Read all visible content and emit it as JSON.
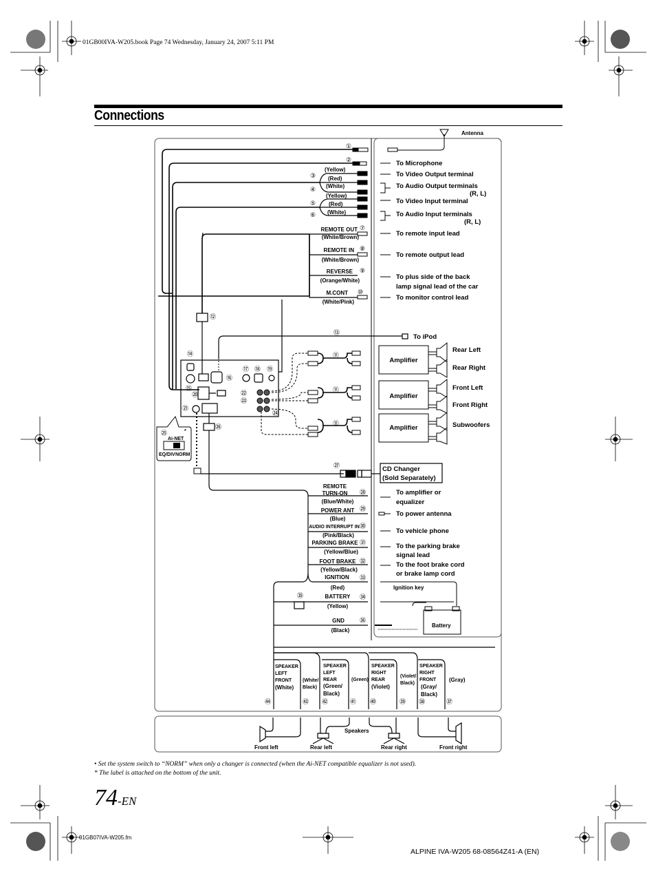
{
  "header": {
    "book_meta": "01GB00IVA-W205.book  Page 74  Wednesday, January 24, 2007  5:11 PM",
    "title": "Connections"
  },
  "diagram": {
    "antenna_label": "Antenna",
    "connectors": [
      {
        "num": "①",
        "wire_color": "",
        "destination": "To Microphone"
      },
      {
        "num": "②",
        "wire_color": "",
        "destination": "To Video Output terminal"
      },
      {
        "num": "③",
        "wire_color": "(Yellow) (Red)",
        "destination": "To Audio Output terminals (R, L)"
      },
      {
        "num": "④",
        "wire_color": "(White)",
        "destination": ""
      },
      {
        "num": "⑤",
        "wire_color": "(Yellow) (Red)",
        "destination": "To Video Input terminal"
      },
      {
        "num": "⑥",
        "wire_color": "(White)",
        "destination": "To Audio Input terminals (R, L)"
      }
    ],
    "rca_colors": [
      "(Yellow)",
      "(Red)",
      "(White)",
      "(Yellow)",
      "(Red)",
      "(White)"
    ],
    "nums_top": [
      "①",
      "②",
      "③",
      "④",
      "⑤",
      "⑥"
    ],
    "dest_top": [
      "To Microphone",
      "To Video Output terminal",
      "To Audio Output terminals",
      "(R, L)",
      "To Video Input terminal",
      "To Audio Input terminals",
      "(R, L)"
    ],
    "leads_mid": [
      {
        "name": "REMOTE OUT",
        "num": "⑦",
        "color": "(White/Brown)",
        "dest": "To remote input lead"
      },
      {
        "name": "REMOTE IN",
        "num": "⑧",
        "color": "(White/Brown)",
        "dest": "To remote output lead"
      },
      {
        "name": "REVERSE",
        "num": "⑨",
        "color": "(Orange/White)",
        "dest": "To plus side of the back",
        "dest2": "lamp signal lead of the car"
      },
      {
        "name": "M.CONT",
        "num": "⑩",
        "color": "(White/Pink)",
        "dest": "To monitor control lead"
      }
    ],
    "unit_nums": {
      "n11": "⑪",
      "n12": "⑫",
      "n13": "⑬",
      "n14": "⑭",
      "n15": "⑮",
      "n16": "⑯",
      "n17": "⑰",
      "n18": "⑱",
      "n19": "⑲",
      "n20": "⑳",
      "n21": "㉑",
      "n22": "㉒",
      "n23": "㉓",
      "n24": "㉔",
      "n25": "㉕",
      "n26": "㉖",
      "n27": "㉗"
    },
    "ipod_label": "To iPod",
    "ainet_box": {
      "label": "Ai-NET",
      "left": "EQ/DIV",
      "right": "NORM",
      "asterisk": "*"
    },
    "amplifiers": [
      {
        "label": "Amplifier",
        "outputs": [
          "Rear Left",
          "Rear Right"
        ]
      },
      {
        "label": "Amplifier",
        "outputs": [
          "Front Left",
          "Front Right"
        ]
      },
      {
        "label": "Amplifier",
        "outputs": [
          "Subwoofers"
        ]
      }
    ],
    "cd_changer": {
      "line1": "CD Changer",
      "line2": "(Sold Separately)"
    },
    "leads_low": [
      {
        "name": "REMOTE",
        "name2": "TURN-ON",
        "num": "㉘",
        "color": "(Blue/White)",
        "dest": "To amplifier or",
        "dest2": "equalizer"
      },
      {
        "name": "POWER ANT",
        "num": "㉙",
        "color": "(Blue)",
        "dest": "To power antenna"
      },
      {
        "name": "AUDIO INTERRUPT IN",
        "num": "㉚",
        "color": "(Pink/Black)",
        "dest": "To vehicle phone"
      },
      {
        "name": "PARKING BRAKE",
        "num": "㉛",
        "color": "(Yellow/Blue)",
        "dest": "To the parking brake",
        "dest2": "signal lead"
      },
      {
        "name": "FOOT BRAKE",
        "num": "㉜",
        "color": "(Yellow/Black)",
        "dest": "To the foot brake cord",
        "dest2": "or brake lamp cord"
      },
      {
        "name": "IGNITION",
        "num": "㉝",
        "color": "(Red)",
        "dest": ""
      },
      {
        "name": "BATTERY",
        "num": "㉞",
        "color": "(Yellow)",
        "dest": ""
      },
      {
        "name": "GND",
        "num": "㊱",
        "color": "(Black)",
        "dest": ""
      }
    ],
    "fuse_num": "㉟",
    "ignition_key": "Ignition key",
    "battery_label": "Battery",
    "speaker_leads": [
      {
        "l1": "SPEAKER",
        "l2": "LEFT",
        "l3": "FRONT",
        "l4": "(White)",
        "num": "㊹"
      },
      {
        "l1": "(White/",
        "l2": "Black)",
        "num": "㊸"
      },
      {
        "l1": "SPEAKER",
        "l2": "LEFT",
        "l3": "REAR",
        "l4": "(Green/",
        "l5": "Black)",
        "num": "㊷"
      },
      {
        "l1": "(Green)",
        "num": "㊶"
      },
      {
        "l1": "SPEAKER",
        "l2": "RIGHT",
        "l3": "REAR",
        "l4": "(Violet)",
        "num": "㊵"
      },
      {
        "l1": "(Violet/",
        "l2": "Black)",
        "num": "㊴"
      },
      {
        "l1": "SPEAKER",
        "l2": "RIGHT",
        "l3": "FRONT",
        "l4": "(Gray/",
        "l5": "Black)",
        "num": "㊳"
      },
      {
        "l1": "(Gray)",
        "num": "㊲"
      }
    ],
    "speakers": {
      "title": "Speakers",
      "names": [
        "Front left",
        "Rear left",
        "Rear right",
        "Front right"
      ]
    }
  },
  "notes": {
    "bullet": "•   Set the system switch to “NORM” when only a changer is connected (when the Ai-NET compatible equalizer is not used).",
    "asterisk": "* The label is attached on the bottom of the unit."
  },
  "footer": {
    "page_number": "74",
    "page_suffix": "-EN",
    "file_name": "01GB07IVA-W205.fm",
    "doc_code": "ALPINE IVA-W205 68-08564Z41-A (EN)"
  }
}
